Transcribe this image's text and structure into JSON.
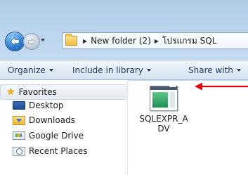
{
  "address_bar": {
    "crumbs": [
      "New folder (2)",
      "โปรแกรม SQL"
    ]
  },
  "toolbar": {
    "organize_label": "Organize",
    "include_label": "Include in library",
    "share_label": "Share with"
  },
  "nav_pane": {
    "favorites_label": "Favorites",
    "items": [
      {
        "label": "Desktop",
        "icon": "desktop-icon"
      },
      {
        "label": "Downloads",
        "icon": "downloads-icon"
      },
      {
        "label": "Google Drive",
        "icon": "google-drive-icon"
      },
      {
        "label": "Recent Places",
        "icon": "recent-places-icon"
      }
    ]
  },
  "content": {
    "files": [
      {
        "name": "SQLEXPR_ADV",
        "icon": "sql-installer-icon"
      }
    ]
  },
  "annotation": {
    "arrow_color": "#e8000b"
  }
}
